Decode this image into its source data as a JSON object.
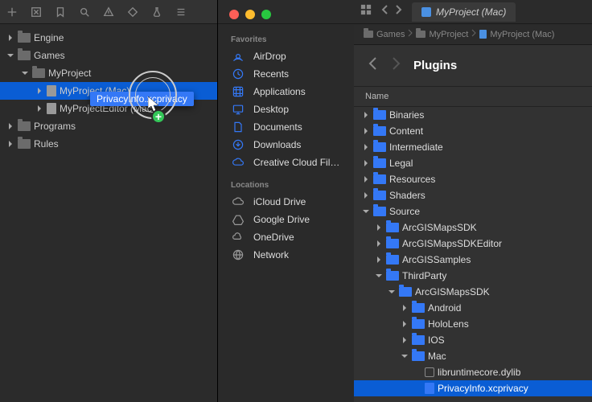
{
  "toolbar_icons": [
    "plus",
    "x",
    "bookmark",
    "search",
    "warning",
    "diamond",
    "flask",
    "link"
  ],
  "tab": {
    "label": "MyProject (Mac)"
  },
  "breadcrumb": [
    {
      "icon": "folder",
      "label": "Games"
    },
    {
      "icon": "folder",
      "label": "MyProject"
    },
    {
      "icon": "file",
      "label": "MyProject (Mac)"
    }
  ],
  "ide_tree": [
    {
      "label": "Engine",
      "depth": 0,
      "expanded": false,
      "icon": "folder"
    },
    {
      "label": "Games",
      "depth": 0,
      "expanded": true,
      "icon": "folder"
    },
    {
      "label": "MyProject",
      "depth": 1,
      "expanded": true,
      "icon": "folder"
    },
    {
      "label": "MyProject (Mac)",
      "depth": 2,
      "expanded": false,
      "icon": "file",
      "selected": true
    },
    {
      "label": "MyProjectEditor (Mac)",
      "depth": 2,
      "expanded": false,
      "icon": "file"
    },
    {
      "label": "Programs",
      "depth": 0,
      "expanded": false,
      "icon": "folder"
    },
    {
      "label": "Rules",
      "depth": 0,
      "expanded": false,
      "icon": "folder"
    }
  ],
  "drag": {
    "file_label": "PrivacyInfo.xcprivacy"
  },
  "finder": {
    "favorites_heading": "Favorites",
    "favorites": [
      {
        "label": "AirDrop",
        "icon": "airdrop"
      },
      {
        "label": "Recents",
        "icon": "clock"
      },
      {
        "label": "Applications",
        "icon": "apps"
      },
      {
        "label": "Desktop",
        "icon": "desktop"
      },
      {
        "label": "Documents",
        "icon": "doc"
      },
      {
        "label": "Downloads",
        "icon": "download"
      },
      {
        "label": "Creative Cloud Fil…",
        "icon": "cloud"
      }
    ],
    "locations_heading": "Locations",
    "locations": [
      {
        "label": "iCloud Drive",
        "icon": "icloud"
      },
      {
        "label": "Google Drive",
        "icon": "gdrive"
      },
      {
        "label": "OneDrive",
        "icon": "onedrive"
      },
      {
        "label": "Network",
        "icon": "network"
      }
    ]
  },
  "browser": {
    "title": "Plugins",
    "column": "Name",
    "tree": [
      {
        "label": "Binaries",
        "depth": 0,
        "icon": "folder"
      },
      {
        "label": "Content",
        "depth": 0,
        "icon": "folder"
      },
      {
        "label": "Intermediate",
        "depth": 0,
        "icon": "folder"
      },
      {
        "label": "Legal",
        "depth": 0,
        "icon": "folder"
      },
      {
        "label": "Resources",
        "depth": 0,
        "icon": "folder"
      },
      {
        "label": "Shaders",
        "depth": 0,
        "icon": "folder"
      },
      {
        "label": "Source",
        "depth": 0,
        "icon": "folder",
        "expanded": true
      },
      {
        "label": "ArcGISMapsSDK",
        "depth": 1,
        "icon": "folder"
      },
      {
        "label": "ArcGISMapsSDKEditor",
        "depth": 1,
        "icon": "folder"
      },
      {
        "label": "ArcGISSamples",
        "depth": 1,
        "icon": "folder"
      },
      {
        "label": "ThirdParty",
        "depth": 1,
        "icon": "folder",
        "expanded": true
      },
      {
        "label": "ArcGISMapsSDK",
        "depth": 2,
        "icon": "folder",
        "expanded": true
      },
      {
        "label": "Android",
        "depth": 3,
        "icon": "folder"
      },
      {
        "label": "HoloLens",
        "depth": 3,
        "icon": "folder"
      },
      {
        "label": "IOS",
        "depth": 3,
        "icon": "folder"
      },
      {
        "label": "Mac",
        "depth": 3,
        "icon": "folder",
        "expanded": true
      },
      {
        "label": "libruntimecore.dylib",
        "depth": 4,
        "icon": "file",
        "checkbox": true
      },
      {
        "label": "PrivacyInfo.xcprivacy",
        "depth": 4,
        "icon": "file-blue",
        "selected": true
      }
    ]
  }
}
